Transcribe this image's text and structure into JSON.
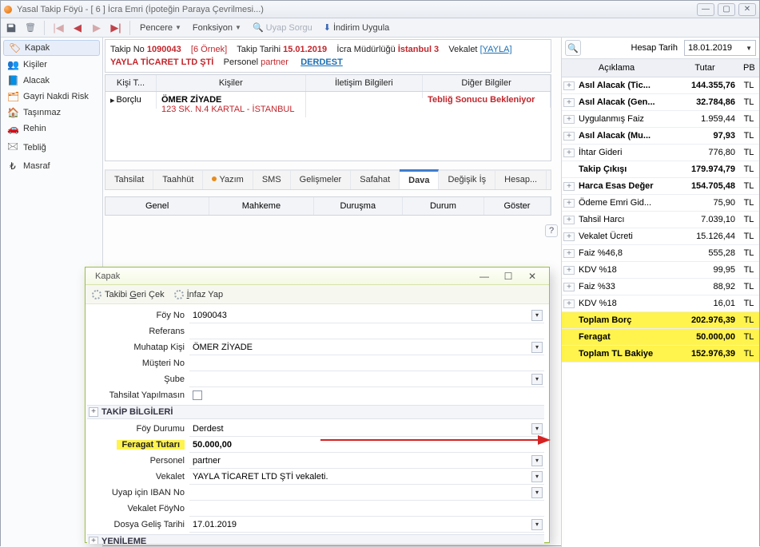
{
  "window": {
    "title": "Yasal Takip Föyü - [ 6 ] İcra Emri (İpoteğin Paraya Çevrilmesi...)"
  },
  "toolbar": {
    "pencere": "Pencere",
    "fonksiyon": "Fonksiyon",
    "uyap_sorgu": "Uyap Sorgu",
    "indirim": "İndirim Uygula"
  },
  "sidebar": {
    "items": [
      {
        "icon": "cover",
        "label": "Kapak"
      },
      {
        "icon": "people",
        "label": "Kişiler"
      },
      {
        "icon": "receivable",
        "label": "Alacak"
      },
      {
        "icon": "risk",
        "label": "Gayri Nakdi Risk"
      },
      {
        "icon": "estate",
        "label": "Taşınmaz"
      },
      {
        "icon": "pledge",
        "label": "Rehin"
      },
      {
        "icon": "notice",
        "label": "Tebliğ"
      },
      {
        "icon": "expense",
        "label": "Masraf"
      }
    ]
  },
  "header": {
    "takip_no_label": "Takip No",
    "takip_no": "1090043",
    "ornek": "[6 Örnek]",
    "takip_tarihi_label": "Takip Tarihi",
    "takip_tarihi": "15.01.2019",
    "mudurluk_label": "İcra Müdürlüğü",
    "mudurluk": "İstanbul 3",
    "vekalet_label": "Vekalet",
    "vekalet_link": "[YAYLA]",
    "line2_company": "YAYLA TİCARET LTD ŞTİ",
    "personel_label": "Personel",
    "personel": "partner",
    "status": "DERDEST"
  },
  "people_grid": {
    "head": {
      "c1": "Kişi T...",
      "c2": "Kişiler",
      "c3": "İletişim Bilgileri",
      "c4": "Diğer Bilgiler"
    },
    "row": {
      "type": "Borçlu",
      "name": "ÖMER ZİYADE",
      "addr": "123 SK. N.4   KARTAL - İSTANBUL",
      "other": "Tebliğ Sonucu Bekleniyor"
    }
  },
  "midtabs": {
    "tahsilat": "Tahsilat",
    "taahhut": "Taahhüt",
    "yazim": "Yazım",
    "sms": "SMS",
    "gelismeler": "Gelişmeler",
    "safahat": "Safahat",
    "dava": "Dava",
    "degisik": "Değişik İş",
    "hesap": "Hesap..."
  },
  "subheader": {
    "c1": "Genel",
    "c2": "Mahkeme",
    "c3": "Duruşma",
    "c4": "Durum",
    "c5": "Göster"
  },
  "right": {
    "hesap_tarih_label": "Hesap Tarih",
    "hesap_tarih": "18.01.2019",
    "head": {
      "c1": "Açıklama",
      "c2": "Tutar",
      "c3": "PB"
    },
    "rows": [
      {
        "exp": true,
        "bold": true,
        "name": "Asıl Alacak (Tic...",
        "amt": "144.355,76",
        "pb": "TL"
      },
      {
        "exp": true,
        "bold": true,
        "name": "Asıl Alacak (Gen...",
        "amt": "32.784,86",
        "pb": "TL"
      },
      {
        "exp": true,
        "bold": false,
        "name": "Uygulanmış Faiz",
        "amt": "1.959,44",
        "pb": "TL"
      },
      {
        "exp": true,
        "bold": true,
        "name": "Asıl Alacak (Mu...",
        "amt": "97,93",
        "pb": "TL"
      },
      {
        "exp": true,
        "bold": false,
        "name": "İhtar Gideri",
        "amt": "776,80",
        "pb": "TL"
      },
      {
        "exp": false,
        "bold": true,
        "name": "Takip Çıkışı",
        "amt": "179.974,79",
        "pb": "TL"
      },
      {
        "exp": true,
        "bold": true,
        "name": "Harca Esas Değer",
        "amt": "154.705,48",
        "pb": "TL"
      },
      {
        "exp": true,
        "bold": false,
        "name": "Ödeme Emri Gid...",
        "amt": "75,90",
        "pb": "TL"
      },
      {
        "exp": true,
        "bold": false,
        "name": "Tahsil Harcı",
        "amt": "7.039,10",
        "pb": "TL"
      },
      {
        "exp": true,
        "bold": false,
        "name": "Vekalet Ücreti",
        "amt": "15.126,44",
        "pb": "TL"
      },
      {
        "exp": true,
        "bold": false,
        "name": "Faiz  %46,8",
        "amt": "555,28",
        "pb": "TL"
      },
      {
        "exp": true,
        "bold": false,
        "name": "KDV %18",
        "amt": "99,95",
        "pb": "TL"
      },
      {
        "exp": true,
        "bold": false,
        "name": "Faiz  %33",
        "amt": "88,92",
        "pb": "TL"
      },
      {
        "exp": true,
        "bold": false,
        "name": "KDV %18",
        "amt": "16,01",
        "pb": "TL"
      },
      {
        "hl": true,
        "bold": true,
        "name": "Toplam Borç",
        "amt": "202.976,39",
        "pb": "TL"
      },
      {
        "hl": true,
        "bold": false,
        "name": "Feragat",
        "amt": "50.000,00",
        "pb": "TL"
      },
      {
        "hl": true,
        "bold": true,
        "name": "Toplam TL Bakiye",
        "amt": "152.976,39",
        "pb": "TL"
      }
    ]
  },
  "modal": {
    "title": "Kapak",
    "tb": {
      "geri_cek": "Takibi Geri Çek",
      "infaz": "İnfaz Yap"
    },
    "fields": {
      "foy_no_label": "Föy No",
      "foy_no": "1090043",
      "referans_label": "Referans",
      "referans": "",
      "muhatap_label": "Muhatap Kişi",
      "muhatap": "ÖMER ZİYADE",
      "musteri_label": "Müşteri No",
      "musteri": "",
      "sube_label": "Şube",
      "sube": "",
      "tahsilat_yapilmasin_label": "Tahsilat Yapılmasın",
      "section1": "TAKİP BİLGİLERİ",
      "durum_label": "Föy Durumu",
      "durum": "Derdest",
      "feragat_label": "Feragat Tutarı",
      "feragat": "50.000,00",
      "personel_label": "Personel",
      "personel": "partner",
      "vekalet_label": "Vekalet",
      "vekalet": "YAYLA TİCARET LTD ŞTİ vekaleti.",
      "iban_label": "Uyap için IBAN No",
      "iban": "",
      "vek_foyno_label": "Vekalet FöyNo",
      "vek_foyno": "",
      "gelis_label": "Dosya Geliş Tarihi",
      "gelis": "17.01.2019",
      "section2": "YENİLEME"
    }
  }
}
